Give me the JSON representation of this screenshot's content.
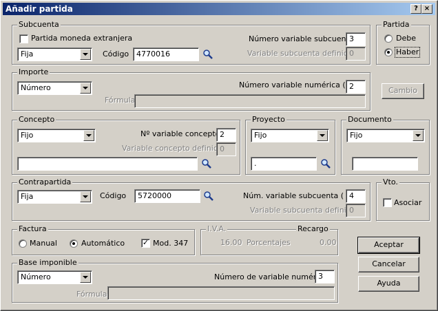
{
  "window": {
    "title": "Añadir partida",
    "help": "?",
    "close": "×"
  },
  "subcuenta": {
    "title": "Subcuenta",
    "moneda_label": "Partida moneda extranjera",
    "tipo": "Fija",
    "codigo_label": "Código",
    "codigo": "4770016",
    "num_var_label": "Número variable subcuenta",
    "num_var": "3",
    "var_def_label": "Variable subcuenta definida",
    "var_def": "0"
  },
  "partida": {
    "title": "Partida",
    "debe": "Debe",
    "haber": "Haber"
  },
  "importe": {
    "title": "Importe",
    "tipo": "Número",
    "num_label": "Número variable numérica ( N )",
    "num": "2",
    "formula_label": "Fórmula",
    "formula": ""
  },
  "cambio_button": "Cambio",
  "concepto": {
    "title": "Concepto",
    "tipo": "Fijo",
    "num_label": "Nº variable concepto",
    "num": "2",
    "var_def_label": "Variable concepto definida",
    "var_def": "0",
    "text": ""
  },
  "proyecto": {
    "title": "Proyecto",
    "tipo": "Fijo",
    "text": "."
  },
  "documento": {
    "title": "Documento",
    "tipo": "Fijo",
    "text": ""
  },
  "contrapartida": {
    "title": "Contrapartida",
    "tipo": "Fija",
    "codigo_label": "Código",
    "codigo": "5720000",
    "num_var_label": "Núm. variable subcuenta ( N )",
    "num_var": "4",
    "var_def_label": "Variable subcuenta definida",
    "var_def": "0"
  },
  "vto": {
    "title": "Vto.",
    "asociar": "Asociar"
  },
  "factura": {
    "title": "Factura",
    "manual": "Manual",
    "automatico": "Automático",
    "mod347": "Mod. 347"
  },
  "iva": {
    "title": "I.V.A.",
    "recargo_title": "Recargo",
    "value": "16.00",
    "porcentajes": "Porcentajes",
    "recargo_value": "0.00"
  },
  "base": {
    "title": "Base imponible",
    "tipo": "Número",
    "num_label": "Número de variable numérica",
    "num": "3",
    "formula_label": "Fórmula",
    "formula": ""
  },
  "buttons": {
    "aceptar": "Aceptar",
    "cancelar": "Cancelar",
    "ayuda": "Ayuda"
  }
}
